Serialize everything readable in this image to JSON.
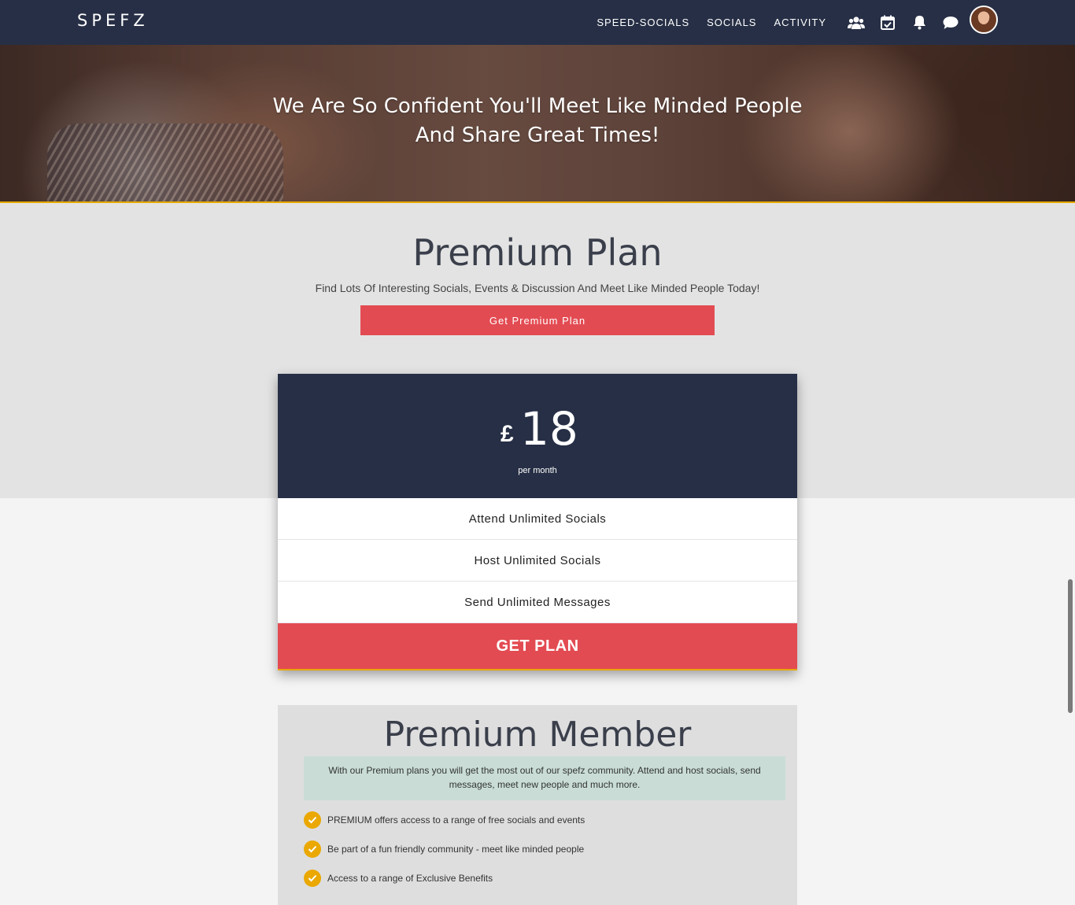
{
  "brand": {
    "logo": "SPEFZ"
  },
  "nav": {
    "links": [
      "SPEED-SOCIALS",
      "SOCIALS",
      "ACTIVITY"
    ],
    "icons": [
      "users-icon",
      "calendar-icon",
      "bell-icon",
      "chat-icon"
    ]
  },
  "hero": {
    "title_line1": "We Are So Confident You'll Meet Like Minded People",
    "title_line2": "And Share Great Times!"
  },
  "plan": {
    "title": "Premium Plan",
    "subtitle": "Find Lots Of Interesting Socials, Events & Discussion And Meet Like Minded People Today!",
    "cta": "Get Premium Plan"
  },
  "pricing": {
    "currency": "£",
    "amount": "18",
    "period": "per month",
    "features": [
      "Attend Unlimited Socials",
      "Host Unlimited Socials",
      "Send Unlimited Messages"
    ],
    "cta": "GET PLAN"
  },
  "member": {
    "title": "Premium Member",
    "note": "With our Premium plans you will get the most out of our spefz community. Attend and host socials, send messages, meet new people and much more.",
    "benefits": [
      "PREMIUM offers access to a range of free socials and events",
      "Be part of a fun friendly community - meet like minded people",
      "Access to a range of Exclusive Benefits"
    ]
  },
  "colors": {
    "navy": "#262f45",
    "accent_red": "#e34b52",
    "gold": "#e7a900",
    "mint": "#c9ddd6"
  }
}
